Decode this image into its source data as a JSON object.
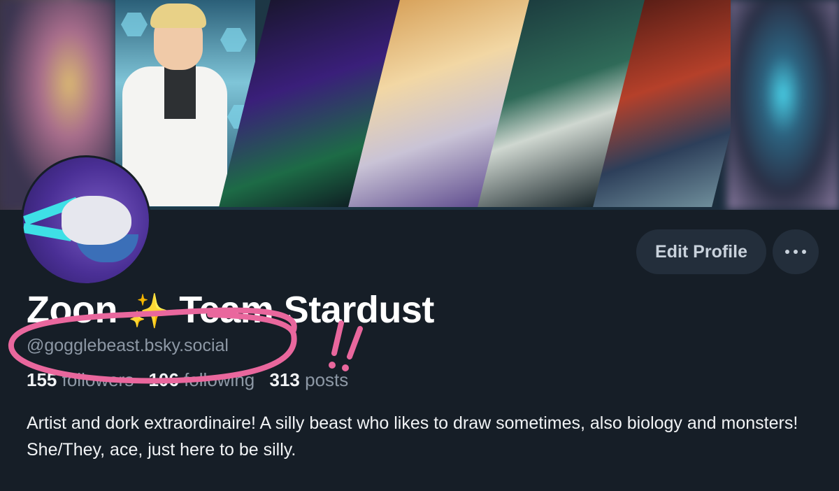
{
  "profile": {
    "display_name": "Zoon",
    "display_name_rest": "Team Stardust",
    "handle": "@gogglebeast.bsky.social",
    "bio": "Artist and dork extraordinaire! A silly beast who likes to draw sometimes, also biology and monsters! She/They, ace, just here to be silly."
  },
  "stats": {
    "followers_count": "155",
    "followers_label": "followers",
    "following_count": "106",
    "following_label": "following",
    "posts_count": "313",
    "posts_label": "posts"
  },
  "actions": {
    "edit_profile_label": "Edit Profile"
  },
  "icons": {
    "name_emoji": "sparkles-icon",
    "more_button": "more-dots-icon"
  },
  "colors": {
    "background": "#161e27",
    "button_bg": "#232e3b",
    "muted_text": "#8d98a5",
    "annotation": "#e9679d"
  }
}
